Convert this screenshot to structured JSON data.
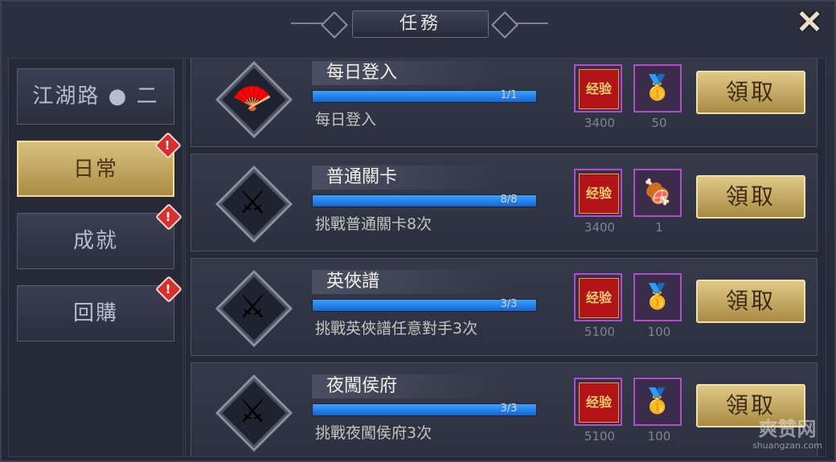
{
  "window": {
    "title": "任務",
    "close_label": "✕"
  },
  "sidebar": {
    "tabs": [
      {
        "label": "江湖路 ● 二",
        "active": false,
        "badge": false
      },
      {
        "label": "日常",
        "active": true,
        "badge": true
      },
      {
        "label": "成就",
        "active": false,
        "badge": true
      },
      {
        "label": "回購",
        "active": false,
        "badge": true
      }
    ],
    "badge_label": "!"
  },
  "tasks": [
    {
      "name": "每日登入",
      "desc": "每日登入",
      "progress_text": "1/1",
      "progress": 1.0,
      "icon": "fan-icon",
      "rewards": [
        {
          "type": "exp",
          "label": "经验",
          "count": "3400"
        },
        {
          "type": "gold",
          "icon": "gold-ingot-icon",
          "count": "50"
        }
      ],
      "claim_label": "領取"
    },
    {
      "name": "普通關卡",
      "desc": "挑戰普通關卡8次",
      "progress_text": "8/8",
      "progress": 1.0,
      "icon": "crossed-swords-shield-icon",
      "rewards": [
        {
          "type": "exp",
          "label": "经验",
          "count": "3400"
        },
        {
          "type": "food",
          "icon": "meat-dish-icon",
          "count": "1"
        }
      ],
      "claim_label": "領取"
    },
    {
      "name": "英俠譜",
      "desc": "挑戰英俠譜任意對手3次",
      "progress_text": "3/3",
      "progress": 1.0,
      "icon": "crossed-blades-emblem-icon",
      "rewards": [
        {
          "type": "exp",
          "label": "经验",
          "count": "5100"
        },
        {
          "type": "gold",
          "icon": "gold-ingot-icon",
          "count": "100"
        }
      ],
      "claim_label": "領取"
    },
    {
      "name": "夜闖侯府",
      "desc": "挑戰夜闖侯府3次",
      "progress_text": "3/3",
      "progress": 1.0,
      "icon": "crossed-blades-emblem-icon",
      "rewards": [
        {
          "type": "exp",
          "label": "经验",
          "count": "5100"
        },
        {
          "type": "gold",
          "icon": "gold-ingot-icon",
          "count": "100"
        }
      ],
      "claim_label": "領取"
    }
  ],
  "watermark": {
    "main": "爽赞网",
    "sub": "shuangzan.com"
  }
}
